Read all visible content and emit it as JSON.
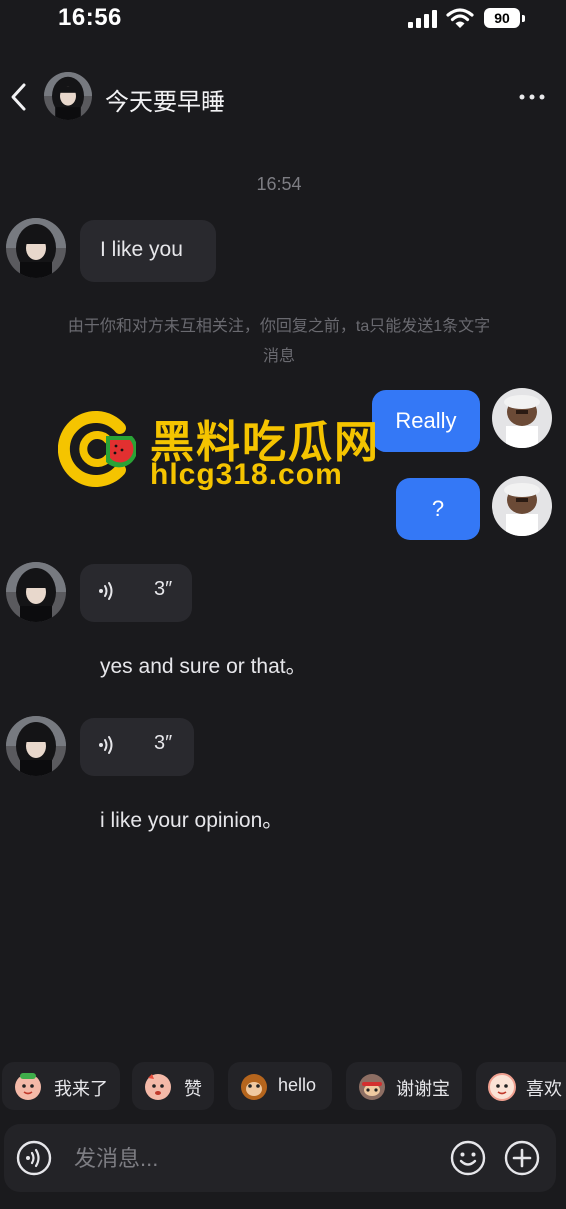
{
  "status_bar": {
    "time": "16:56",
    "battery": "90"
  },
  "header": {
    "title": "今天要早睡"
  },
  "chat": {
    "timestamp": "16:54",
    "messages": [
      {
        "from": "them",
        "type": "text",
        "text": "I like you"
      },
      {
        "from": "me",
        "type": "text",
        "text": "Really"
      },
      {
        "from": "me",
        "type": "text",
        "text": "?"
      },
      {
        "from": "them",
        "type": "voice",
        "duration": "3″",
        "transcript": "yes and sure or that。"
      },
      {
        "from": "them",
        "type": "voice",
        "duration": "3″",
        "transcript": "i like your opinion。"
      }
    ],
    "notice_line1": "由于你和对方未互相关注，你回复之前，ta只能发送1条文字",
    "notice_line2": "消息"
  },
  "watermark": {
    "title": "黑料吃瓜网",
    "url": "hlcg318.com"
  },
  "quick_replies": [
    "我来了",
    "赞",
    "hello",
    "谢谢宝",
    "喜欢"
  ],
  "input": {
    "placeholder": "发消息..."
  },
  "icons": {
    "back": "chevron-left-icon",
    "more": "more-horizontal-icon",
    "voice": "voice-wave-icon",
    "emoji": "smiley-icon",
    "plus": "plus-circle-icon"
  },
  "colors": {
    "background": "#1a1a1d",
    "accent": "#3478f6",
    "bubble_in": "#29292e",
    "watermark": "#f5c400"
  }
}
